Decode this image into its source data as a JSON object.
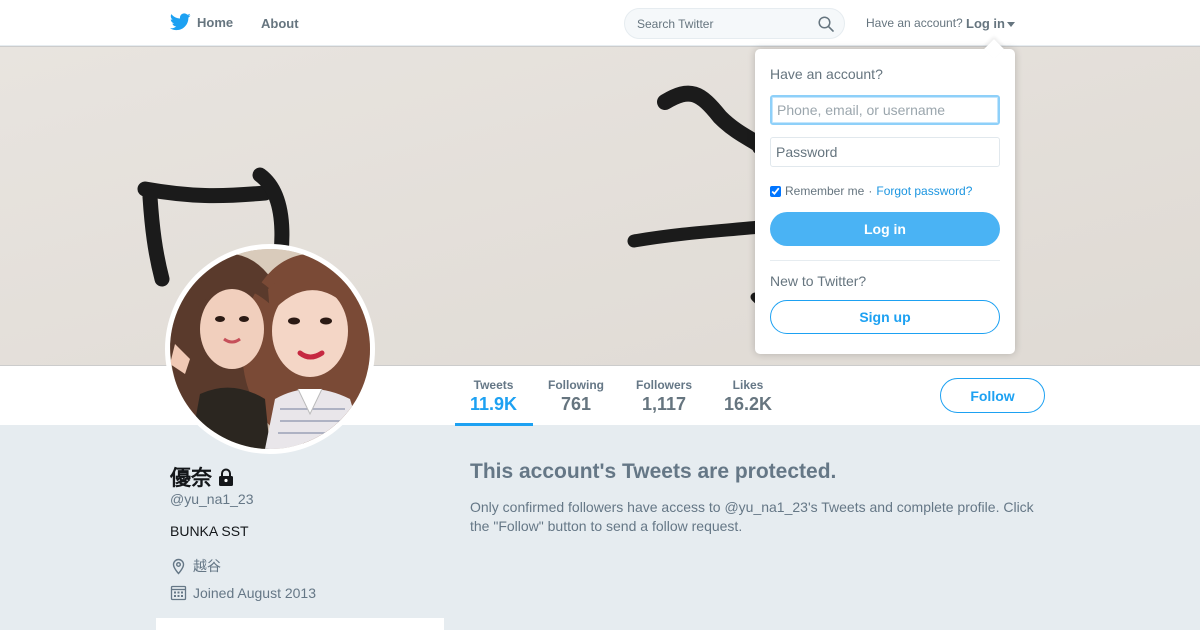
{
  "nav": {
    "home_label": "Home",
    "about_label": "About",
    "search_placeholder": "Search Twitter",
    "have_account": "Have an account?",
    "login_label": "Log in"
  },
  "profile": {
    "name": "優奈",
    "handle": "@yu_na1_23",
    "bio": "BUNKA SST",
    "location": "越谷",
    "joined": "Joined August 2013"
  },
  "stats": [
    {
      "label": "Tweets",
      "value": "11.9K",
      "active": true
    },
    {
      "label": "Following",
      "value": "761",
      "active": false
    },
    {
      "label": "Followers",
      "value": "1,117",
      "active": false
    },
    {
      "label": "Likes",
      "value": "16.2K",
      "active": false
    }
  ],
  "follow_label": "Follow",
  "protected": {
    "title": "This account's Tweets are protected.",
    "text": "Only confirmed followers have access to @yu_na1_23's Tweets and complete profile. Click the \"Follow\" button to send a follow request."
  },
  "login_dropdown": {
    "title": "Have an account?",
    "username_placeholder": "Phone, email, or username",
    "password_placeholder": "Password",
    "remember_label": "Remember me",
    "separator": "·",
    "forgot_label": "Forgot password?",
    "login_button": "Log in",
    "new_label": "New to Twitter?",
    "signup_button": "Sign up"
  },
  "colors": {
    "accent": "#1da1f2",
    "login_button_bg": "#4ab3f4",
    "page_bg": "#e6ecf0"
  }
}
